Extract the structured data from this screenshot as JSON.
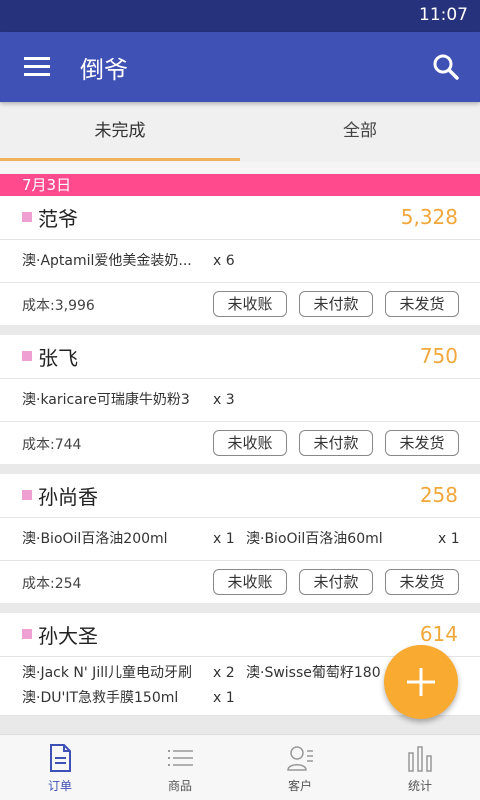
{
  "status_bar": {
    "time": "11:07"
  },
  "app_bar": {
    "title": "倒爷"
  },
  "tabs": [
    {
      "label": "未完成",
      "active": true
    },
    {
      "label": "全部",
      "active": false
    }
  ],
  "date_group": "7月3日",
  "orders": [
    {
      "customer": "范爷",
      "amount": "5,328",
      "items": [
        {
          "name": "澳·Aptamil爱他美金装奶...",
          "qty": "x 6"
        }
      ],
      "cost": "成本:3,996",
      "status": [
        "未收账",
        "未付款",
        "未发货"
      ]
    },
    {
      "customer": "张飞",
      "amount": "750",
      "items": [
        {
          "name": "澳·karicare可瑞康牛奶粉3",
          "qty": "x 3"
        }
      ],
      "cost": "成本:744",
      "status": [
        "未收账",
        "未付款",
        "未发货"
      ]
    },
    {
      "customer": "孙尚香",
      "amount": "258",
      "items": [
        {
          "name": "澳·BioOil百洛油200ml",
          "qty": "x 1"
        },
        {
          "name": "澳·BioOil百洛油60ml",
          "qty": "x 1"
        }
      ],
      "cost": "成本:254",
      "status": [
        "未收账",
        "未付款",
        "未发货"
      ]
    },
    {
      "customer": "孙大圣",
      "amount": "614",
      "items": [
        {
          "name": "澳·Jack N' Jill儿童电动牙刷",
          "qty": "x 2"
        },
        {
          "name": "澳·Swisse葡萄籽180",
          "qty": ""
        },
        {
          "name": "澳·DU'IT急救手膜150ml",
          "qty": "x 1"
        }
      ]
    }
  ],
  "bottom_nav": [
    {
      "label": "订单",
      "icon": "document-icon",
      "active": true
    },
    {
      "label": "商品",
      "icon": "list-icon",
      "active": false
    },
    {
      "label": "客户",
      "icon": "contact-icon",
      "active": false
    },
    {
      "label": "统计",
      "icon": "bar-chart-icon",
      "active": false
    }
  ],
  "colors": {
    "primary": "#3f51b5",
    "status_bar": "#27327c",
    "accent": "#f2a73b",
    "fab": "#f8aa31",
    "date_band": "#ff4a8d",
    "customer_marker": "#ef9fd1"
  }
}
